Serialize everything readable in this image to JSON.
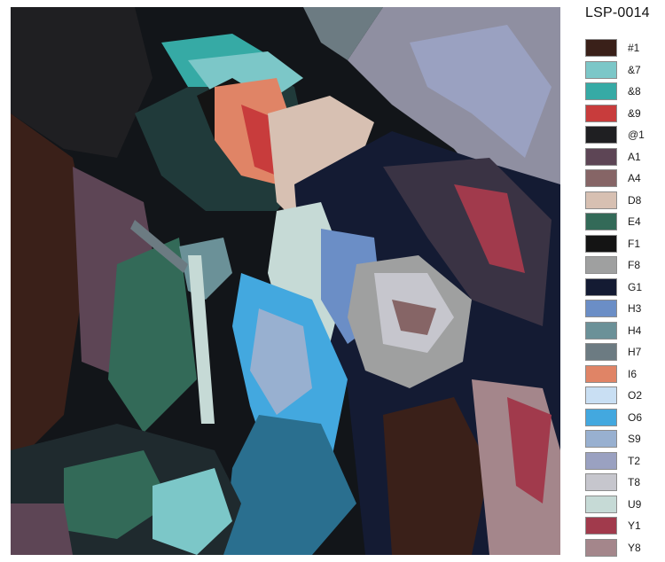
{
  "product_code": "LSP-0014",
  "palette": [
    {
      "code": "#1",
      "color": "#3a2019"
    },
    {
      "code": "&7",
      "color": "#7cc7c8"
    },
    {
      "code": "&8",
      "color": "#36aaa5"
    },
    {
      "code": "&9",
      "color": "#c83c3c"
    },
    {
      "code": "@1",
      "color": "#1f1f22"
    },
    {
      "code": "A1",
      "color": "#5d4555"
    },
    {
      "code": "A4",
      "color": "#866566"
    },
    {
      "code": "D8",
      "color": "#d7c0b2"
    },
    {
      "code": "E4",
      "color": "#336a58"
    },
    {
      "code": "F1",
      "color": "#141414"
    },
    {
      "code": "F8",
      "color": "#9fa0a0"
    },
    {
      "code": "G1",
      "color": "#141b33"
    },
    {
      "code": "H3",
      "color": "#6b8ec6"
    },
    {
      "code": "H4",
      "color": "#6b9198"
    },
    {
      "code": "H7",
      "color": "#6c7b82"
    },
    {
      "code": "I6",
      "color": "#e08466"
    },
    {
      "code": "O2",
      "color": "#c9dff3"
    },
    {
      "code": "O6",
      "color": "#43a8df"
    },
    {
      "code": "S9",
      "color": "#98b0d0"
    },
    {
      "code": "T2",
      "color": "#9aa1c1"
    },
    {
      "code": "T8",
      "color": "#c6c6cd"
    },
    {
      "code": "U9",
      "color": "#c6dad6"
    },
    {
      "code": "Y1",
      "color": "#a13a4c"
    },
    {
      "code": "Y8",
      "color": "#a4868b"
    }
  ]
}
